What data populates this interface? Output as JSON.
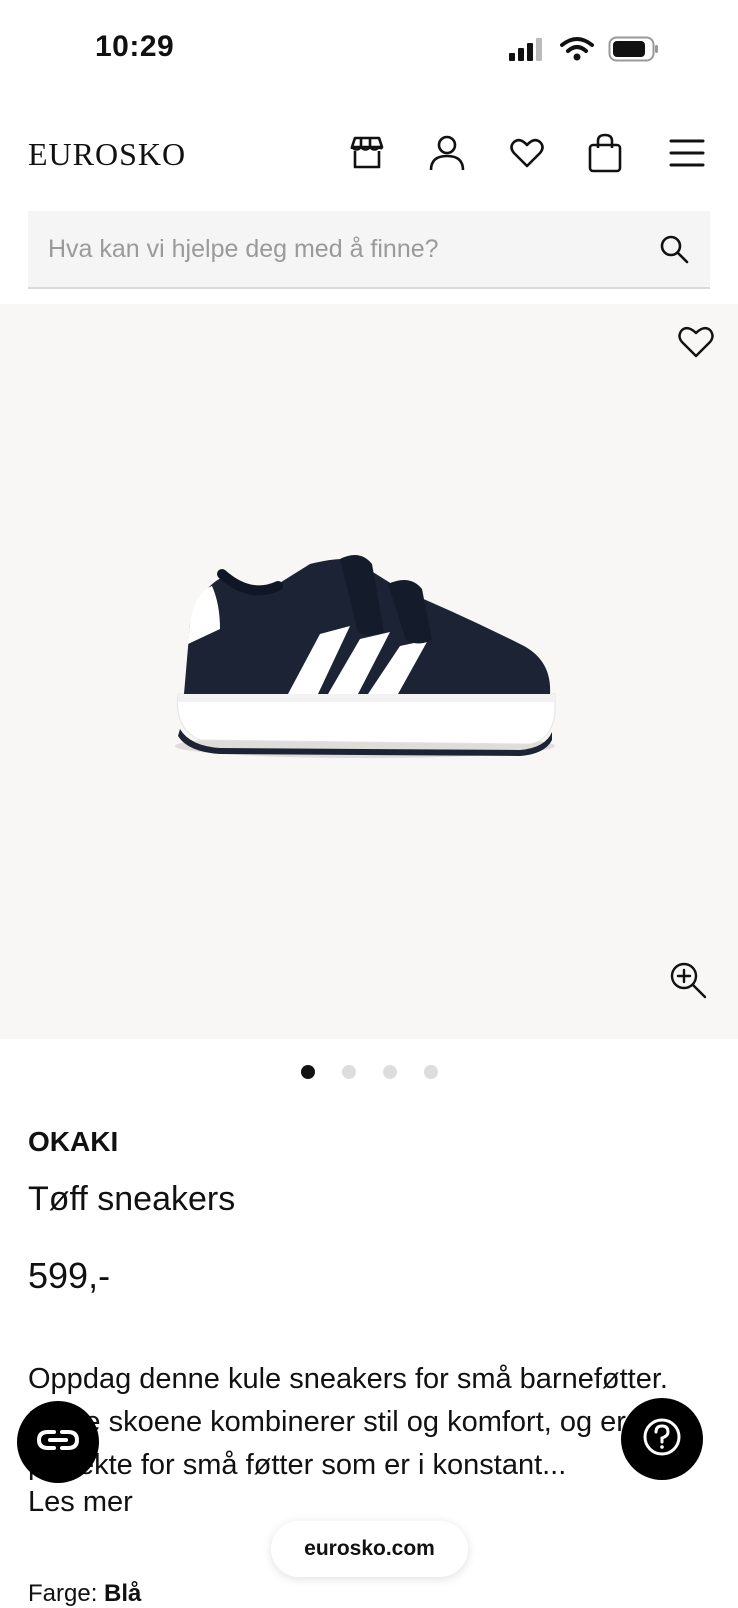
{
  "status": {
    "time": "10:29",
    "icons": [
      "signal-icon",
      "wifi-icon",
      "battery-icon"
    ]
  },
  "header": {
    "logo": "EUROSKO",
    "icons": [
      "store-icon",
      "account-icon",
      "wishlist-icon",
      "cart-icon",
      "menu-icon"
    ]
  },
  "search": {
    "placeholder": "Hva kan vi hjelpe deg med å finne?"
  },
  "gallery": {
    "image_count": 4,
    "active_index": 0
  },
  "product": {
    "brand": "OKAKI",
    "name": "Tøff sneakers",
    "price": "599,-",
    "description": "Oppdag denne kule sneakers for små barneføtter. Disse skoene kombinerer stil og komfort, og er perfekte for små føtter som er i konstant...",
    "read_more": "Les mer",
    "color_label": "Farge:",
    "color_value": "Blå"
  },
  "browser": {
    "url": "eurosko.com"
  },
  "colors": {
    "shoe_navy": "#1b2335",
    "gallery_bg": "#f8f7f5",
    "search_bg": "#f5f5f5"
  }
}
